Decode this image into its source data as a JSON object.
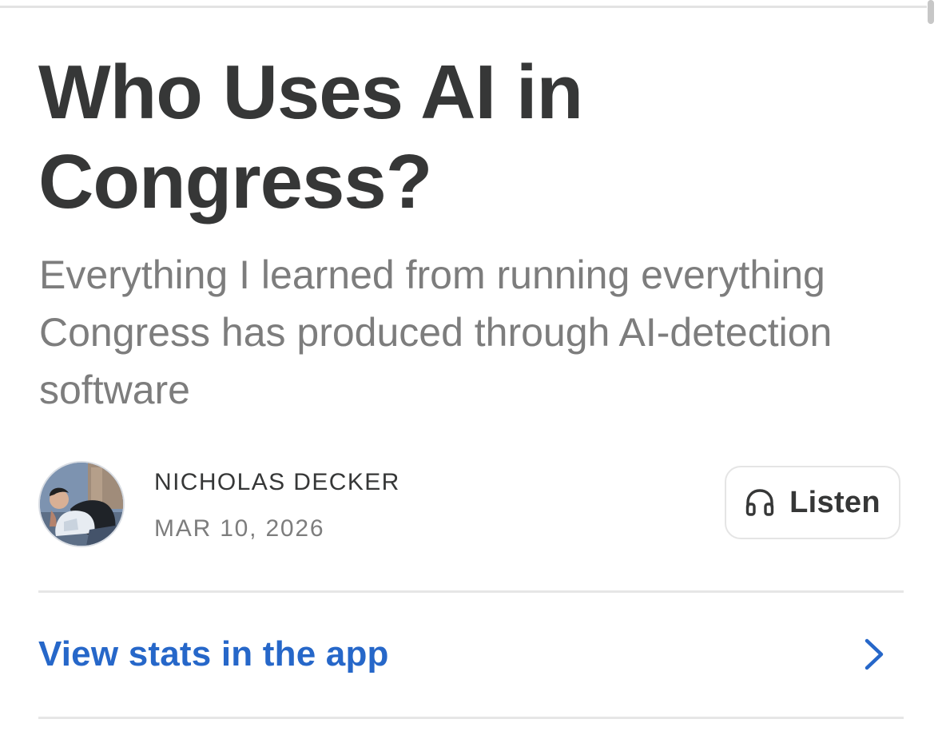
{
  "article": {
    "title": "Who Uses AI in Congress?",
    "subtitle": "Everything I learned from running everything Congress has produced through AI-detection software"
  },
  "byline": {
    "author": "NICHOLAS DECKER",
    "date": "MAR 10, 2026",
    "avatar_icon": "author-photo",
    "listen_label": "Listen",
    "listen_icon": "headphones-icon"
  },
  "stats_link": {
    "label": "View stats in the app",
    "icon": "chevron-right-icon"
  },
  "colors": {
    "title": "#363737",
    "subtitle": "#7d7d7d",
    "link": "#2667c9",
    "divider": "#e6e6e6"
  }
}
